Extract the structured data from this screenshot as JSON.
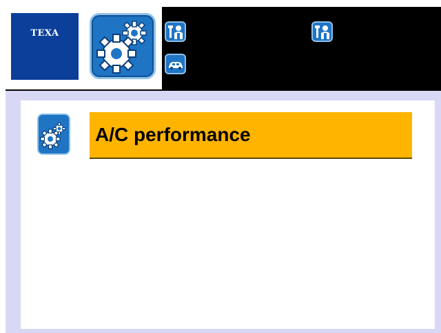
{
  "header": {
    "logo_text": "TEXA",
    "main_icon": "gears-icon",
    "buttons": [
      {
        "icon": "tools-person-icon"
      },
      {
        "icon": "car-icon"
      },
      {
        "icon": "tools-person-icon"
      }
    ]
  },
  "menu": {
    "items": [
      {
        "label": "A/C performance",
        "icon": "gears-icon",
        "selected": true
      }
    ]
  },
  "colors": {
    "header_background": "#000000",
    "logo_background": "#0b3f99",
    "icon_blue": "#1f74c4",
    "selection": "#ffb400",
    "frame": "#d9d8f4"
  }
}
